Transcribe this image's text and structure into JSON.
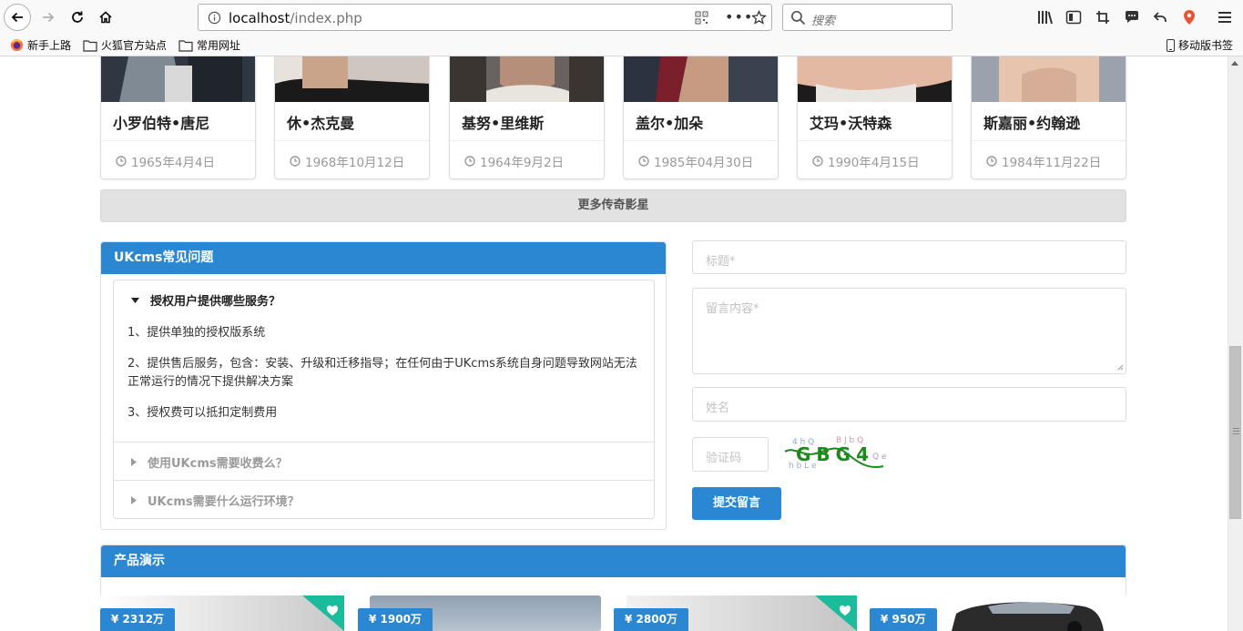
{
  "browser": {
    "url_host": "localhost",
    "url_path": "/index.php",
    "search_placeholder": "搜索",
    "bookmarks": [
      "新手上路",
      "火狐官方站点",
      "常用网址"
    ],
    "mobile_bookmarks": "移动版书签"
  },
  "stars": {
    "items": [
      {
        "name": "小罗伯特•唐尼",
        "date": "1965年4月4日"
      },
      {
        "name": "休•杰克曼",
        "date": "1968年10月12日"
      },
      {
        "name": "基努•里维斯",
        "date": "1964年9月2日"
      },
      {
        "name": "盖尔•加朵",
        "date": "1985年04月30日"
      },
      {
        "name": "艾玛•沃特森",
        "date": "1990年4月15日"
      },
      {
        "name": "斯嘉丽•约翰逊",
        "date": "1984年11月22日"
      }
    ],
    "more_label": "更多传奇影星"
  },
  "faq": {
    "title": "UKcms常见问题",
    "open_question": "授权用户提供哪些服务？",
    "answers": [
      "1、提供单独的授权版系统",
      "2、提供售后服务，包含：安装、升级和迁移指导；在任何由于UKcms系统自身问题导致网站无法正常运行的情况下提供解决方案",
      "3、授权费可以抵扣定制费用"
    ],
    "closed_questions": [
      "使用UKcms需要收费么？",
      "UKcms需要什么运行环境？"
    ]
  },
  "form": {
    "title_placeholder": "标题*",
    "content_placeholder": "留言内容*",
    "name_placeholder": "姓名",
    "captcha_placeholder": "验证码",
    "captcha_text": "GBG4",
    "submit_label": "提交留言"
  },
  "products": {
    "title": "产品演示",
    "prices": [
      "¥ 2312万",
      "¥ 1900万",
      "¥ 2800万",
      "¥ 950万"
    ]
  },
  "colors": {
    "primary": "#2b87d1",
    "fav": "#1bbc9b"
  }
}
